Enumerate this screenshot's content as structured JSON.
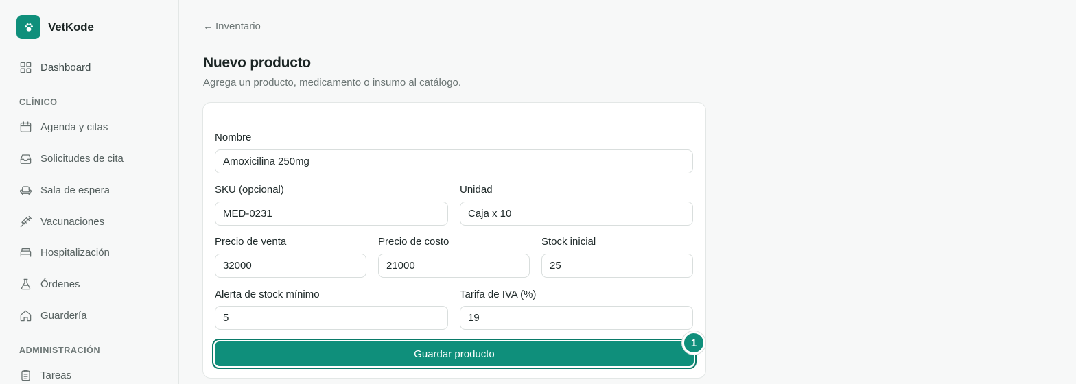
{
  "brand": {
    "name": "VetKode",
    "logo_icon": "paw-icon"
  },
  "sidebar": {
    "dashboard": {
      "label": "Dashboard",
      "icon": "grid-icon"
    },
    "sections": [
      {
        "title": "CLÍNICO",
        "items": [
          {
            "label": "Agenda y citas",
            "icon": "calendar-icon"
          },
          {
            "label": "Solicitudes de cita",
            "icon": "inbox-icon"
          },
          {
            "label": "Sala de espera",
            "icon": "armchair-icon"
          },
          {
            "label": "Vacunaciones",
            "icon": "syringe-icon"
          },
          {
            "label": "Hospitalización",
            "icon": "bed-icon"
          },
          {
            "label": "Órdenes",
            "icon": "flask-icon"
          },
          {
            "label": "Guardería",
            "icon": "home-icon"
          }
        ]
      },
      {
        "title": "ADMINISTRACIÓN",
        "items": [
          {
            "label": "Tareas",
            "icon": "clipboard-icon"
          }
        ]
      }
    ]
  },
  "header": {
    "back_label": "Inventario",
    "title": "Nuevo producto",
    "subtitle": "Agrega un producto, medicamento o insumo al catálogo."
  },
  "form": {
    "nombre": {
      "label": "Nombre",
      "value": "Amoxicilina 250mg"
    },
    "sku": {
      "label": "SKU (opcional)",
      "value": "MED-0231"
    },
    "unidad": {
      "label": "Unidad",
      "value": "Caja x 10"
    },
    "precio_venta": {
      "label": "Precio de venta",
      "value": "32000"
    },
    "precio_costo": {
      "label": "Precio de costo",
      "value": "21000"
    },
    "stock_inicial": {
      "label": "Stock inicial",
      "value": "25"
    },
    "alerta_stock": {
      "label": "Alerta de stock mínimo",
      "value": "5"
    },
    "tarifa_iva": {
      "label": "Tarifa de IVA (%)",
      "value": "19"
    },
    "submit_label": "Guardar producto",
    "step_badge": "1"
  },
  "colors": {
    "accent": "#0f8f7b",
    "accent_dark": "#0a7a68"
  }
}
